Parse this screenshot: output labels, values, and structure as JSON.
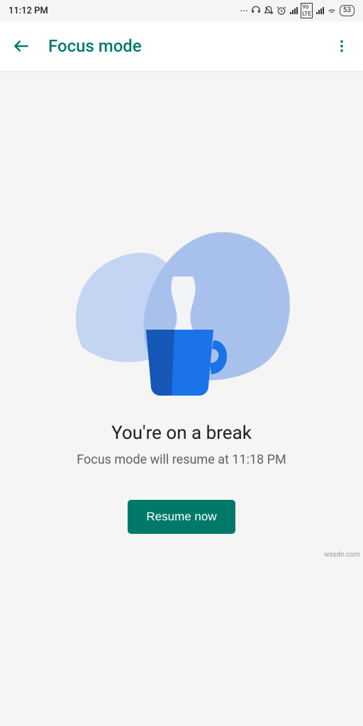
{
  "status_bar": {
    "time": "11:12 PM",
    "battery_level": "53"
  },
  "app_bar": {
    "title": "Focus mode"
  },
  "main": {
    "headline": "You're on a break",
    "subtext": "Focus mode will resume at 11:18 PM",
    "resume_button": "Resume now"
  },
  "watermark": "wsxdn.com",
  "colors": {
    "accent": "#00796b",
    "illustration_blob_light": "#c3d5f2",
    "illustration_blob_mid": "#a8c1ec",
    "mug": "#1a73e8"
  }
}
